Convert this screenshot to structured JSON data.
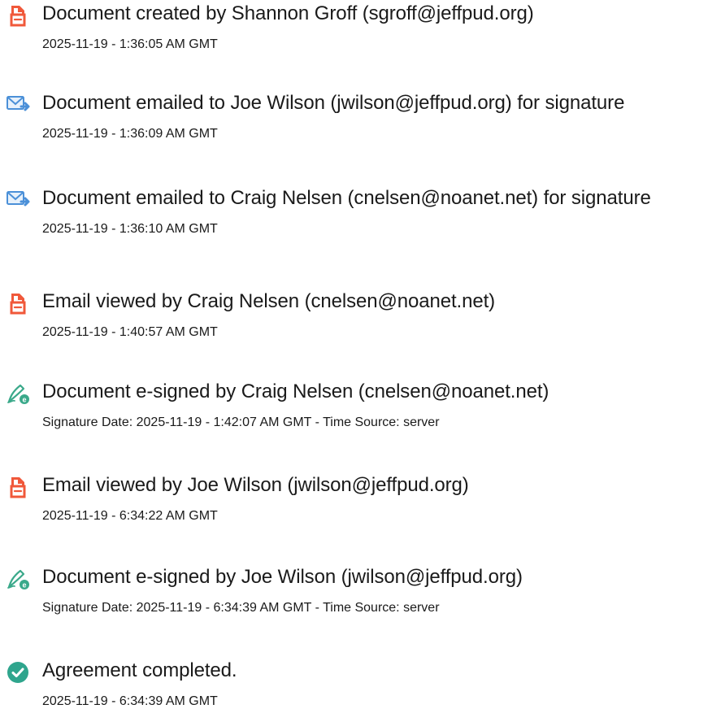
{
  "events": [
    {
      "icon": "document-icon",
      "title": "Document created by Shannon Groff (sgroff@jeffpud.org)",
      "detail": "2025-11-19 - 1:36:05 AM GMT"
    },
    {
      "icon": "email-send-icon",
      "title": "Document emailed to Joe Wilson (jwilson@jeffpud.org) for signature",
      "detail": "2025-11-19 - 1:36:09 AM GMT"
    },
    {
      "icon": "email-send-icon",
      "title": "Document emailed to Craig Nelsen (cnelsen@noanet.net) for signature",
      "detail": "2025-11-19 - 1:36:10 AM GMT"
    },
    {
      "icon": "document-icon",
      "title": "Email viewed by Craig Nelsen (cnelsen@noanet.net)",
      "detail": "2025-11-19 - 1:40:57 AM GMT"
    },
    {
      "icon": "e-sign-pen-icon",
      "title": "Document e-signed by Craig Nelsen (cnelsen@noanet.net)",
      "detail": "Signature Date: 2025-11-19 - 1:42:07 AM GMT - Time Source: server"
    },
    {
      "icon": "document-icon",
      "title": "Email viewed by Joe Wilson (jwilson@jeffpud.org)",
      "detail": "2025-11-19 - 6:34:22 AM GMT"
    },
    {
      "icon": "e-sign-pen-icon",
      "title": "Document e-signed by Joe Wilson (jwilson@jeffpud.org)",
      "detail": "Signature Date: 2025-11-19 - 6:34:39 AM GMT - Time Source: server"
    },
    {
      "icon": "checkmark-circle-icon",
      "title": "Agreement completed.",
      "detail": "2025-11-19 - 6:34:39 AM GMT"
    }
  ],
  "colors": {
    "document_icon": "#f0583a",
    "email_icon": "#4b90d8",
    "sign_pen_icon": "#3aa98a",
    "check_icon": "#2fa58d",
    "text": "#1a1a1a"
  }
}
